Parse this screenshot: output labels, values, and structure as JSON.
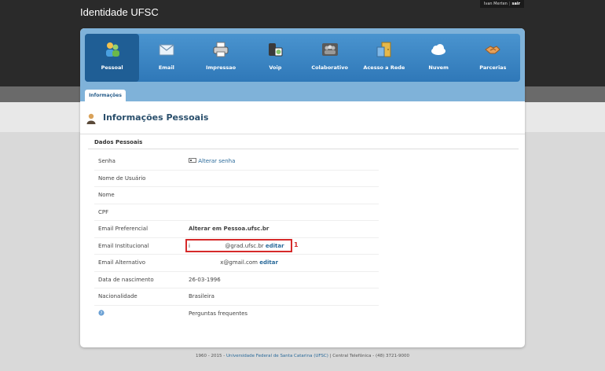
{
  "header": {
    "title": "Identidade UFSC",
    "user_name": "Ivan Merten",
    "logout_label": "sair"
  },
  "nav": {
    "items": [
      {
        "label": "Pessoal",
        "icon": "person-icon",
        "color": "#3a8ad1",
        "active": true
      },
      {
        "label": "Email",
        "icon": "email-icon",
        "color": "#b9d6ee"
      },
      {
        "label": "Impressao",
        "icon": "printer-icon",
        "color": "#d8d8d8"
      },
      {
        "label": "Voip",
        "icon": "voip-phone-icon",
        "color": "#86c46c"
      },
      {
        "label": "Colaborativo",
        "icon": "group-icon",
        "color": "#5a5a5a"
      },
      {
        "label": "Acesso a Rede",
        "icon": "network-access-icon",
        "color": "#e6b84a"
      },
      {
        "label": "Nuvem",
        "icon": "cloud-icon",
        "color": "#ffffff"
      },
      {
        "label": "Parcerias",
        "icon": "handshake-icon",
        "color": "#e6a05a"
      }
    ]
  },
  "tab": {
    "label": "Informações"
  },
  "page": {
    "title": "Informações Pessoais"
  },
  "section": {
    "title": "Dados Pessoais"
  },
  "rows": [
    {
      "label": "Senha",
      "value": "Alterar senha"
    },
    {
      "label": "Nome de Usuário",
      "value": ""
    },
    {
      "label": "Nome",
      "value": ""
    },
    {
      "label": "CPF",
      "value": ""
    },
    {
      "label": "Email Preferencial",
      "value": "Alterar em Pessoa.ufsc.br"
    },
    {
      "label": "Email Institucional",
      "value_prefix": "i",
      "value": "@grad.ufsc.br",
      "action": "editar"
    },
    {
      "label": "Email Alternativo",
      "value": "x@gmail.com",
      "action": "editar"
    },
    {
      "label": "Data de nascimento",
      "value": "26-03-1996"
    },
    {
      "label": "Nacionalidade",
      "value": "Brasileira"
    },
    {
      "label": "",
      "value": "Perguntas frequentes"
    }
  ],
  "annotation": {
    "marker": "1",
    "color": "#d62a2a"
  },
  "footer": {
    "prefix": "1960 - 2015 - ",
    "link": "Universidade Federal de Santa Catarina (UFSC)",
    "suffix": " | Central Telefônica - (48) 3721-9000"
  }
}
